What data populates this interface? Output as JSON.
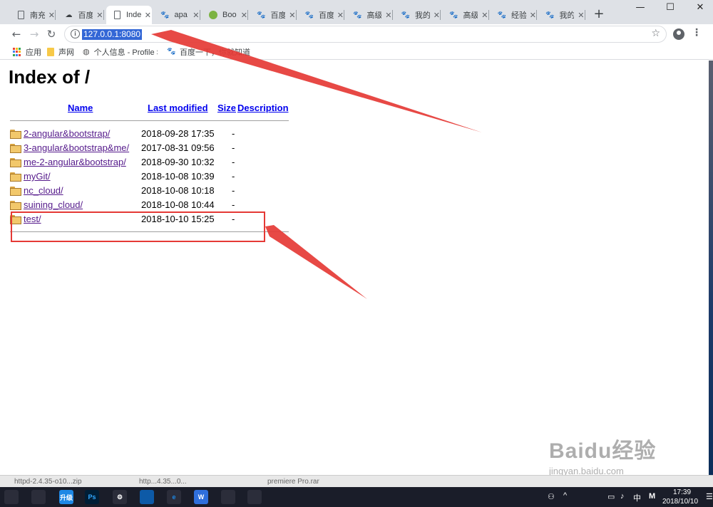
{
  "browser": {
    "tabs": [
      {
        "label": "南充",
        "icon": "page-icon",
        "active": false
      },
      {
        "label": "百度",
        "icon": "cloud-icon",
        "active": false
      },
      {
        "label": "Inde",
        "icon": "page-icon",
        "active": true
      },
      {
        "label": "apa",
        "icon": "baidu-paw-icon",
        "active": false
      },
      {
        "label": "Boo",
        "icon": "bootcdn-icon",
        "active": false
      },
      {
        "label": "百度",
        "icon": "baidu-paw-icon",
        "active": false
      },
      {
        "label": "百度",
        "icon": "baidu-paw-icon",
        "active": false
      },
      {
        "label": "高级",
        "icon": "baidu-paw-icon",
        "active": false
      },
      {
        "label": "我的",
        "icon": "baidu-paw-icon",
        "active": false
      },
      {
        "label": "高级",
        "icon": "baidu-paw-icon",
        "active": false
      },
      {
        "label": "经验",
        "icon": "baidu-paw-icon",
        "active": false
      },
      {
        "label": "我的",
        "icon": "baidu-paw-icon",
        "active": false
      }
    ],
    "tab_close_glyph": "✕",
    "new_tab_glyph": "+",
    "window_controls": {
      "minimize": "—",
      "maximize": "☐",
      "close": "✕"
    },
    "nav": {
      "back": "←",
      "forward": "→",
      "reload": "↻"
    },
    "url": "127.0.0.1:8080",
    "info_glyph": "i",
    "star_glyph": "☆",
    "menu_glyph": "⋮"
  },
  "bookmarks": [
    {
      "label": "应用",
      "icon": "apps-grid-icon"
    },
    {
      "label": "声网",
      "icon": "folder-icon"
    },
    {
      "label": "个人信息 - Profile Se",
      "icon": "globe-icon"
    },
    {
      "label": "百度一下，你就知道",
      "icon": "baidu-paw-icon"
    }
  ],
  "listing": {
    "title": "Index of /",
    "columns": {
      "name": "Name",
      "last_modified": "Last modified",
      "size": "Size",
      "description": "Description"
    },
    "entries": [
      {
        "name": "2-angular&bootstrap/",
        "modified": "2018-09-28 17:35",
        "size": "-"
      },
      {
        "name": "3-angular&bootstrap&me/",
        "modified": "2017-08-31 09:56",
        "size": "-"
      },
      {
        "name": "me-2-angular&bootstrap/",
        "modified": "2018-09-30 10:32",
        "size": "-"
      },
      {
        "name": "myGit/",
        "modified": "2018-10-08 10:39",
        "size": "-"
      },
      {
        "name": "nc_cloud/",
        "modified": "2018-10-08 10:18",
        "size": "-"
      },
      {
        "name": "suining_cloud/",
        "modified": "2018-10-08 10:44",
        "size": "-"
      },
      {
        "name": "test/",
        "modified": "2018-10-10 15:25",
        "size": "-"
      }
    ]
  },
  "annotation_color": "#e53935",
  "watermark": {
    "logo": "Baidu经验",
    "url": "jingyan.baidu.com"
  },
  "background_window": {
    "items": [
      "httpd-2.4.35-o10...zip",
      "http...4.35...0...",
      "premiere Pro.rar"
    ]
  },
  "taskbar": {
    "apps": [
      {
        "icon": "pen-app-icon",
        "label": ""
      },
      {
        "icon": "qq-penguin-icon",
        "label": ""
      },
      {
        "icon": "upgrade-app-icon",
        "label": "升级"
      },
      {
        "icon": "photoshop-icon",
        "label": "Ps"
      },
      {
        "icon": "settings-gear-icon",
        "label": "⚙"
      },
      {
        "icon": "network-app-icon",
        "label": ""
      },
      {
        "icon": "ie-browser-icon",
        "label": "e"
      },
      {
        "icon": "wps-writer-icon",
        "label": "W"
      },
      {
        "icon": "image-viewer-icon",
        "label": ""
      },
      {
        "icon": "notepad-icon",
        "label": ""
      }
    ],
    "ime": "中",
    "m_label": "M",
    "time": "17:39",
    "date": "2018/10/10"
  }
}
